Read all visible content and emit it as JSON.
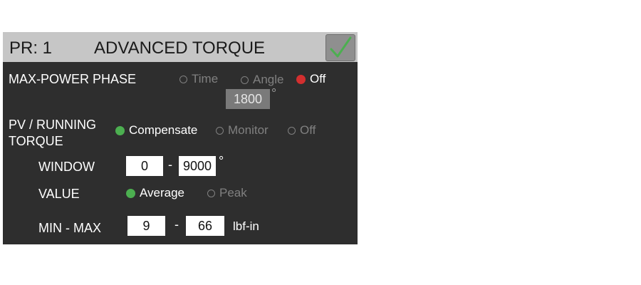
{
  "header": {
    "program": "PR: 1",
    "title": "ADVANCED TORQUE"
  },
  "max_power_phase": {
    "label": "MAX-POWER PHASE",
    "options": [
      {
        "label": "Time",
        "selected": false
      },
      {
        "label": "Angle",
        "selected": false
      },
      {
        "label": "Off",
        "selected": true
      }
    ],
    "value": "1800",
    "unit": "°"
  },
  "pv_running_torque": {
    "label_line1": "PV / RUNNING",
    "label_line2": "TORQUE",
    "options": [
      {
        "label": "Compensate",
        "selected": true
      },
      {
        "label": "Monitor",
        "selected": false
      },
      {
        "label": "Off",
        "selected": false
      }
    ]
  },
  "window": {
    "label": "WINDOW",
    "min": "0",
    "separator": "-",
    "max": "9000",
    "unit": "°"
  },
  "value": {
    "label": "VALUE",
    "options": [
      {
        "label": "Average",
        "selected": true
      },
      {
        "label": "Peak",
        "selected": false
      }
    ]
  },
  "min_max": {
    "label": "MIN - MAX",
    "min": "9",
    "separator": "-",
    "max": "66",
    "unit": "lbf-in"
  },
  "colors": {
    "panel_bg": "#2e2e2e",
    "header_bg": "#c6c6c6",
    "selected_green": "#4caf50",
    "selected_red": "#d32f2f",
    "unselected_gray": "#808080"
  },
  "icons": {
    "confirm": "checkmark-icon"
  }
}
